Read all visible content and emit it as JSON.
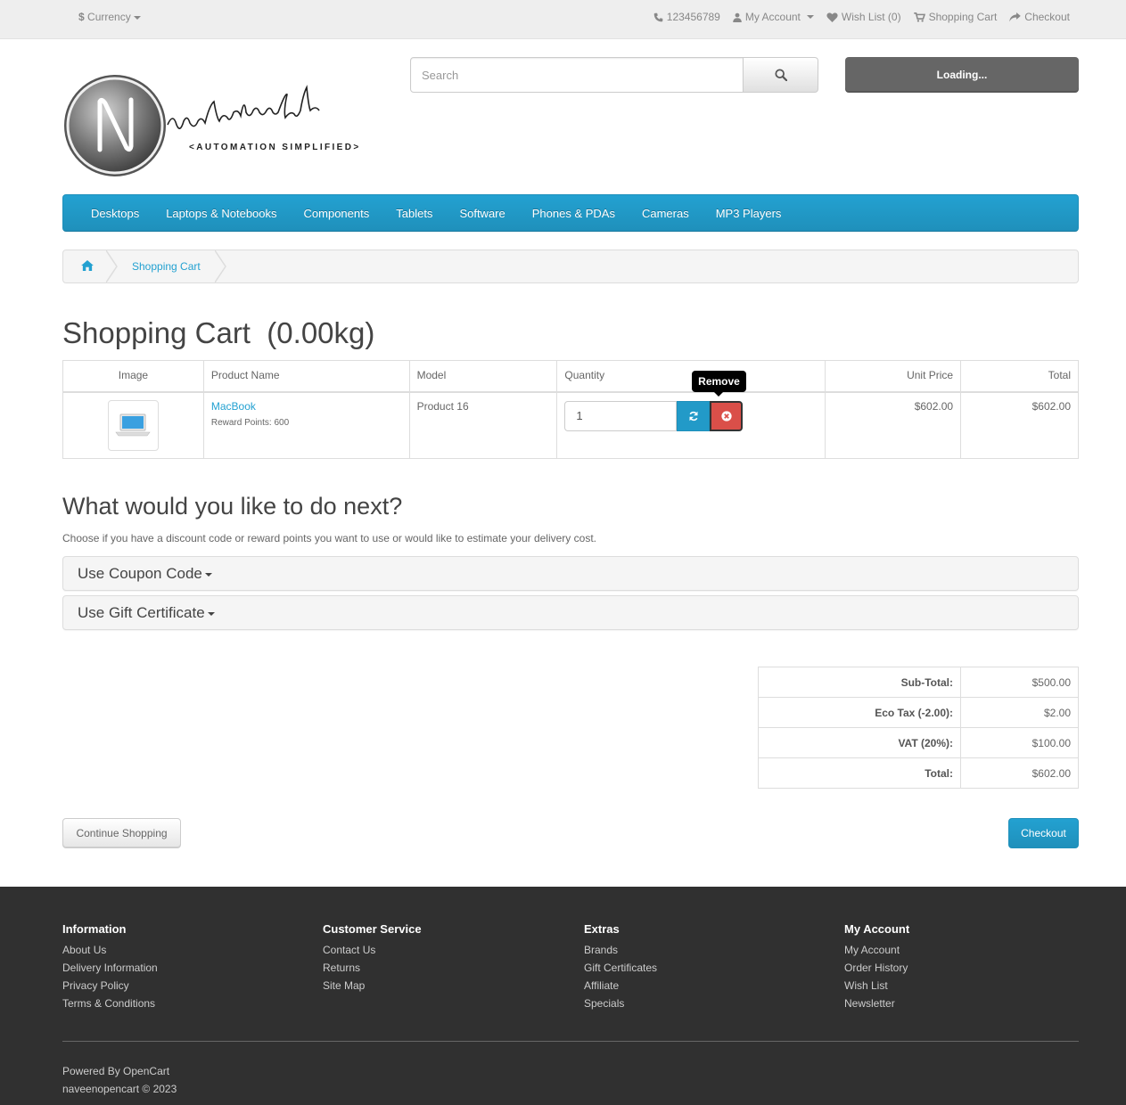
{
  "top": {
    "currency_symbol": "$",
    "currency_label": "Currency",
    "phone": "123456789",
    "my_account": "My Account",
    "wishlist": "Wish List (0)",
    "shopping_cart": "Shopping Cart",
    "checkout": "Checkout"
  },
  "logo": {
    "initial": "N",
    "name": "aveen Automation Labs",
    "tagline": "<AUTOMATION SIMPLIFIED>"
  },
  "search": {
    "placeholder": "Search"
  },
  "cart_button": "Loading...",
  "menu": [
    "Desktops",
    "Laptops & Notebooks",
    "Components",
    "Tablets",
    "Software",
    "Phones & PDAs",
    "Cameras",
    "MP3 Players"
  ],
  "breadcrumb": {
    "current": "Shopping Cart"
  },
  "page_title": "Shopping Cart  (0.00kg)",
  "cart": {
    "headers": [
      "Image",
      "Product Name",
      "Model",
      "Quantity",
      "Unit Price",
      "Total"
    ],
    "items": [
      {
        "name": "MacBook",
        "reward": "Reward Points: 600",
        "model": "Product 16",
        "quantity": "1",
        "unit_price": "$602.00",
        "total": "$602.00"
      }
    ],
    "tooltip": "Remove"
  },
  "next": {
    "title": "What would you like to do next?",
    "description": "Choose if you have a discount code or reward points you want to use or would like to estimate your delivery cost.",
    "panels": [
      "Use Coupon Code",
      "Use Gift Certificate"
    ]
  },
  "totals": [
    {
      "label": "Sub-Total:",
      "value": "$500.00"
    },
    {
      "label": "Eco Tax (-2.00):",
      "value": "$2.00"
    },
    {
      "label": "VAT (20%):",
      "value": "$100.00"
    },
    {
      "label": "Total:",
      "value": "$602.00"
    }
  ],
  "buttons": {
    "continue": "Continue Shopping",
    "checkout": "Checkout"
  },
  "footer": {
    "columns": [
      {
        "title": "Information",
        "links": [
          "About Us",
          "Delivery Information",
          "Privacy Policy",
          "Terms & Conditions"
        ]
      },
      {
        "title": "Customer Service",
        "links": [
          "Contact Us",
          "Returns",
          "Site Map"
        ]
      },
      {
        "title": "Extras",
        "links": [
          "Brands",
          "Gift Certificates",
          "Affiliate",
          "Specials"
        ]
      },
      {
        "title": "My Account",
        "links": [
          "My Account",
          "Order History",
          "Wish List",
          "Newsletter"
        ]
      }
    ],
    "powered_prefix": "Powered By",
    "powered_link": "OpenCart",
    "copyright": "naveenopencart © 2023"
  },
  "colors": {
    "accent": "#23a1d1",
    "danger": "#da4f49",
    "footer_bg": "#303030"
  }
}
